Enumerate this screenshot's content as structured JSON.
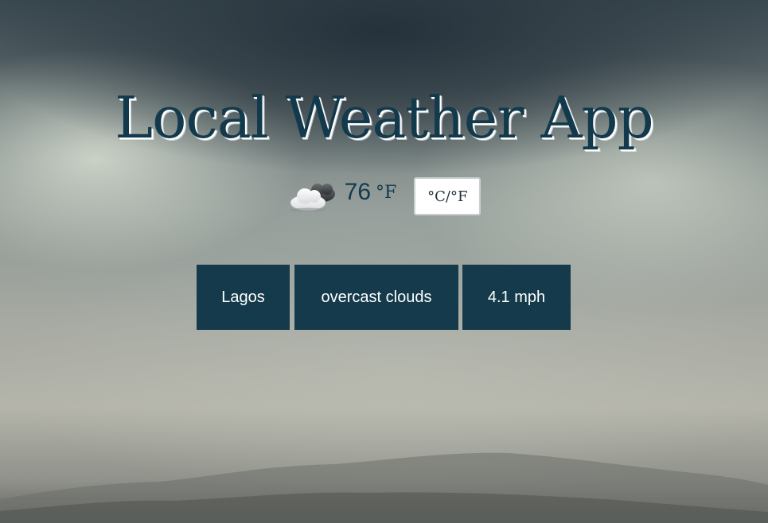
{
  "app": {
    "title": "Local Weather App"
  },
  "weather": {
    "icon": "cloud-sun-icon",
    "temperature": "76",
    "unit": "°F",
    "toggle_label": "°C/°F"
  },
  "info": {
    "city": "Lagos",
    "description": "overcast clouds",
    "wind": "4.1 mph"
  },
  "colors": {
    "title": "#133a4c",
    "box_background": "#143a4b",
    "box_text": "#ffffff",
    "toggle_background": "#ffffff"
  }
}
